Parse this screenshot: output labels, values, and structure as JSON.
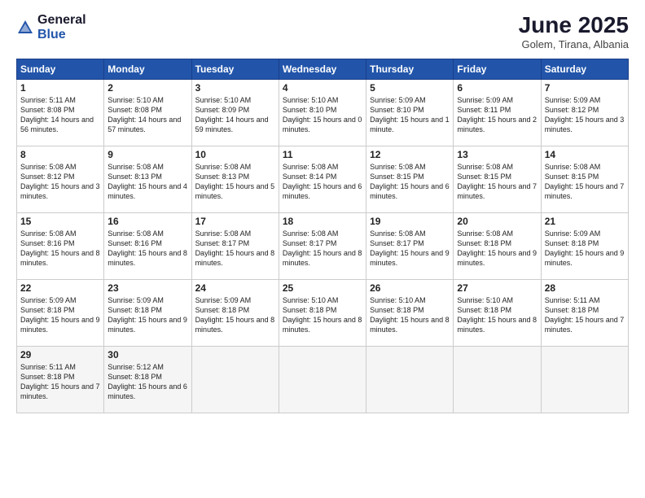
{
  "header": {
    "logo_general": "General",
    "logo_blue": "Blue",
    "month_title": "June 2025",
    "location": "Golem, Tirana, Albania"
  },
  "days_of_week": [
    "Sunday",
    "Monday",
    "Tuesday",
    "Wednesday",
    "Thursday",
    "Friday",
    "Saturday"
  ],
  "weeks": [
    [
      {
        "day": "1",
        "sunrise": "5:11 AM",
        "sunset": "8:08 PM",
        "daylight": "14 hours and 56 minutes."
      },
      {
        "day": "2",
        "sunrise": "5:10 AM",
        "sunset": "8:08 PM",
        "daylight": "14 hours and 57 minutes."
      },
      {
        "day": "3",
        "sunrise": "5:10 AM",
        "sunset": "8:09 PM",
        "daylight": "14 hours and 59 minutes."
      },
      {
        "day": "4",
        "sunrise": "5:10 AM",
        "sunset": "8:10 PM",
        "daylight": "15 hours and 0 minutes."
      },
      {
        "day": "5",
        "sunrise": "5:09 AM",
        "sunset": "8:10 PM",
        "daylight": "15 hours and 1 minute."
      },
      {
        "day": "6",
        "sunrise": "5:09 AM",
        "sunset": "8:11 PM",
        "daylight": "15 hours and 2 minutes."
      },
      {
        "day": "7",
        "sunrise": "5:09 AM",
        "sunset": "8:12 PM",
        "daylight": "15 hours and 3 minutes."
      }
    ],
    [
      {
        "day": "8",
        "sunrise": "5:08 AM",
        "sunset": "8:12 PM",
        "daylight": "15 hours and 3 minutes."
      },
      {
        "day": "9",
        "sunrise": "5:08 AM",
        "sunset": "8:13 PM",
        "daylight": "15 hours and 4 minutes."
      },
      {
        "day": "10",
        "sunrise": "5:08 AM",
        "sunset": "8:13 PM",
        "daylight": "15 hours and 5 minutes."
      },
      {
        "day": "11",
        "sunrise": "5:08 AM",
        "sunset": "8:14 PM",
        "daylight": "15 hours and 6 minutes."
      },
      {
        "day": "12",
        "sunrise": "5:08 AM",
        "sunset": "8:15 PM",
        "daylight": "15 hours and 6 minutes."
      },
      {
        "day": "13",
        "sunrise": "5:08 AM",
        "sunset": "8:15 PM",
        "daylight": "15 hours and 7 minutes."
      },
      {
        "day": "14",
        "sunrise": "5:08 AM",
        "sunset": "8:15 PM",
        "daylight": "15 hours and 7 minutes."
      }
    ],
    [
      {
        "day": "15",
        "sunrise": "5:08 AM",
        "sunset": "8:16 PM",
        "daylight": "15 hours and 8 minutes."
      },
      {
        "day": "16",
        "sunrise": "5:08 AM",
        "sunset": "8:16 PM",
        "daylight": "15 hours and 8 minutes."
      },
      {
        "day": "17",
        "sunrise": "5:08 AM",
        "sunset": "8:17 PM",
        "daylight": "15 hours and 8 minutes."
      },
      {
        "day": "18",
        "sunrise": "5:08 AM",
        "sunset": "8:17 PM",
        "daylight": "15 hours and 8 minutes."
      },
      {
        "day": "19",
        "sunrise": "5:08 AM",
        "sunset": "8:17 PM",
        "daylight": "15 hours and 9 minutes."
      },
      {
        "day": "20",
        "sunrise": "5:08 AM",
        "sunset": "8:18 PM",
        "daylight": "15 hours and 9 minutes."
      },
      {
        "day": "21",
        "sunrise": "5:09 AM",
        "sunset": "8:18 PM",
        "daylight": "15 hours and 9 minutes."
      }
    ],
    [
      {
        "day": "22",
        "sunrise": "5:09 AM",
        "sunset": "8:18 PM",
        "daylight": "15 hours and 9 minutes."
      },
      {
        "day": "23",
        "sunrise": "5:09 AM",
        "sunset": "8:18 PM",
        "daylight": "15 hours and 9 minutes."
      },
      {
        "day": "24",
        "sunrise": "5:09 AM",
        "sunset": "8:18 PM",
        "daylight": "15 hours and 8 minutes."
      },
      {
        "day": "25",
        "sunrise": "5:10 AM",
        "sunset": "8:18 PM",
        "daylight": "15 hours and 8 minutes."
      },
      {
        "day": "26",
        "sunrise": "5:10 AM",
        "sunset": "8:18 PM",
        "daylight": "15 hours and 8 minutes."
      },
      {
        "day": "27",
        "sunrise": "5:10 AM",
        "sunset": "8:18 PM",
        "daylight": "15 hours and 8 minutes."
      },
      {
        "day": "28",
        "sunrise": "5:11 AM",
        "sunset": "8:18 PM",
        "daylight": "15 hours and 7 minutes."
      }
    ],
    [
      {
        "day": "29",
        "sunrise": "5:11 AM",
        "sunset": "8:18 PM",
        "daylight": "15 hours and 7 minutes."
      },
      {
        "day": "30",
        "sunrise": "5:12 AM",
        "sunset": "8:18 PM",
        "daylight": "15 hours and 6 minutes."
      },
      null,
      null,
      null,
      null,
      null
    ]
  ]
}
